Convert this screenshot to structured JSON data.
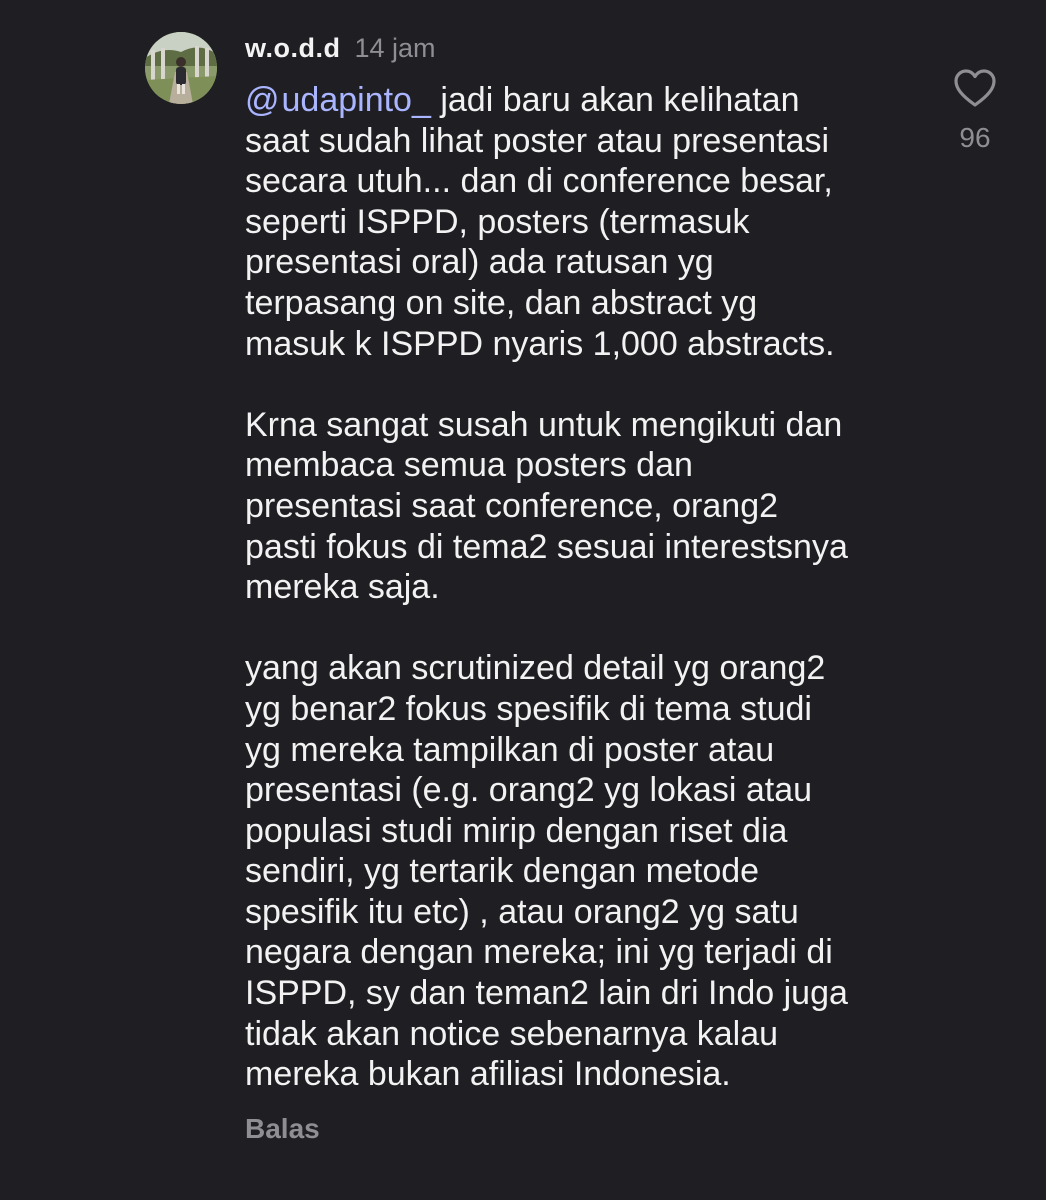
{
  "comment": {
    "username": "w.o.d.d",
    "timestamp": "14 jam",
    "mention_symbol": "@",
    "mention_handle": "udapinto_",
    "paragraphs": [
      " jadi baru akan kelihatan\nsaat sudah lihat poster atau presentasi\nsecara utuh... dan di conference besar,\nseperti ISPPD, posters (termasuk\npresentasi oral) ada ratusan yg\nterpasang on site, dan abstract yg\nmasuk k ISPPD nyaris 1,000 abstracts.",
      "Krna sangat susah untuk mengikuti dan\nmembaca semua posters dan\npresentasi saat conference, orang2\npasti fokus di tema2 sesuai interestsnya\nmereka saja.",
      "yang akan scrutinized detail yg orang2\nyg benar2 fokus spesifik di tema studi\nyg mereka tampilkan di poster atau\npresentasi (e.g. orang2 yg lokasi atau\npopulasi studi mirip dengan riset dia\nsendiri, yg tertarik dengan metode\nspesifik itu etc) , atau orang2 yg satu\nnegara dengan mereka; ini yg terjadi di\nISPPD, sy dan teman2 lain dri Indo juga\ntidak akan notice sebenarnya kalau\nmereka bukan afiliasi Indonesia."
    ],
    "like_count": "96",
    "like_icon": "heart-outline-icon",
    "reply_label": "Balas"
  },
  "colors": {
    "background": "#1f1e23",
    "text": "#f2f2f2",
    "muted": "#8e8e93",
    "mention": "#a9b5ff"
  }
}
